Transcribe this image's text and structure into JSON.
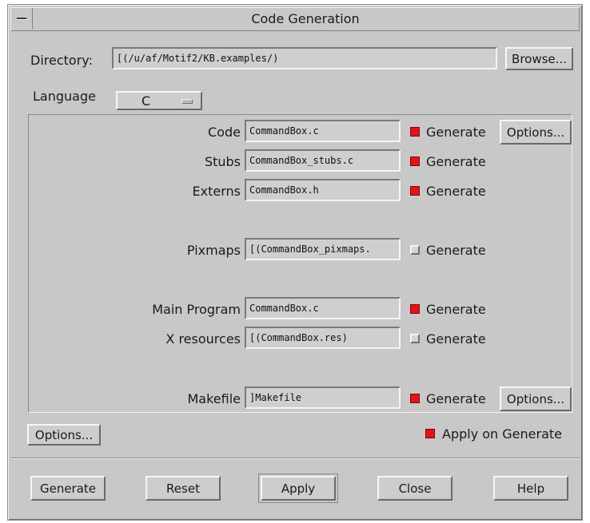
{
  "window": {
    "title": "Code Generation"
  },
  "directory": {
    "label": "Directory:",
    "value": "[(/u/af/Motif2/KB.examples/)",
    "browse_label": "Browse..."
  },
  "language": {
    "label": "Language",
    "value": "C"
  },
  "files": {
    "code": {
      "label": "Code",
      "value": "CommandBox.c",
      "generate_label": "Generate",
      "checked": true,
      "options_label": "Options..."
    },
    "stubs": {
      "label": "Stubs",
      "value": "CommandBox_stubs.c",
      "generate_label": "Generate",
      "checked": true
    },
    "externs": {
      "label": "Externs",
      "value": "CommandBox.h",
      "generate_label": "Generate",
      "checked": true
    },
    "pixmaps": {
      "label": "Pixmaps",
      "value": "[(CommandBox_pixmaps.",
      "generate_label": "Generate",
      "checked": false
    },
    "main_program": {
      "label": "Main Program",
      "value": "CommandBox.c",
      "generate_label": "Generate",
      "checked": true
    },
    "x_resources": {
      "label": "X resources",
      "value": "[(CommandBox.res)",
      "generate_label": "Generate",
      "checked": false
    },
    "makefile": {
      "label": "Makefile",
      "value": "]Makefile",
      "generate_label": "Generate",
      "checked": true,
      "options_label": "Options..."
    }
  },
  "options_button": {
    "label": "Options..."
  },
  "apply_on_generate": {
    "label": "Apply on Generate",
    "checked": true
  },
  "footer": {
    "generate": "Generate",
    "reset": "Reset",
    "apply": "Apply",
    "close": "Close",
    "help": "Help"
  },
  "colors": {
    "background": "#c8c8c8",
    "checked_indicator": "#e0141e"
  }
}
